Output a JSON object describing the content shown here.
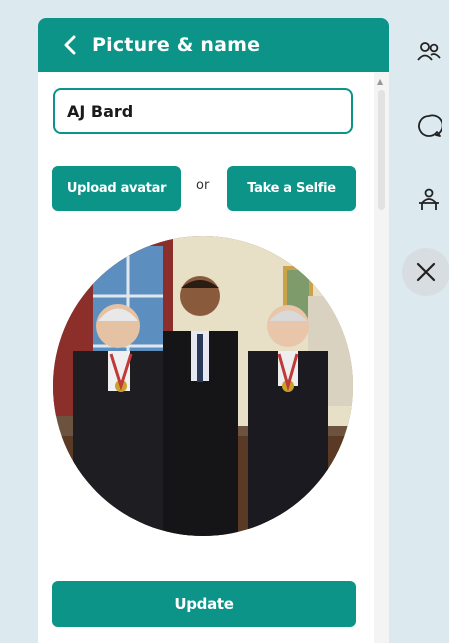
{
  "panel": {
    "title": "Picture & name",
    "name_value": "AJ Bard",
    "upload_label": "Upload avatar",
    "or_label": "or",
    "selfie_label": "Take a Selfie",
    "update_label": "Update"
  },
  "sidebar": {
    "icons": [
      "people-icon",
      "chat-icon",
      "participant-desk-icon",
      "close-icon"
    ]
  },
  "colors": {
    "accent": "#0c9488",
    "panel_bg": "#ffffff",
    "page_bg": "#dceaf0",
    "stripe": "#fbe9b7"
  }
}
